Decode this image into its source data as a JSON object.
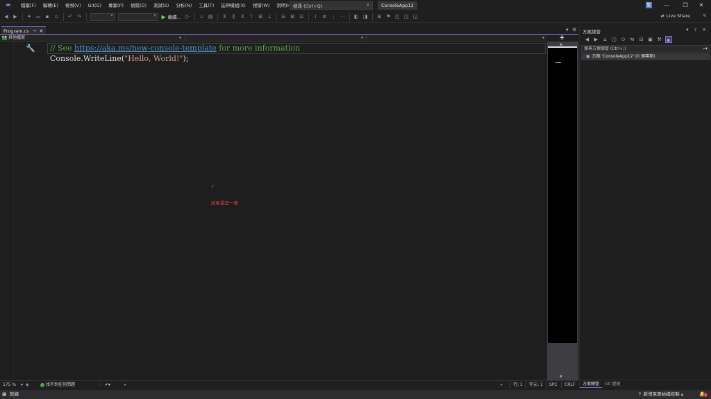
{
  "menu": {
    "items": [
      "檔案(F)",
      "編輯(E)",
      "檢視(V)",
      "Git(G)",
      "專案(P)",
      "偵錯(D)",
      "測試(S)",
      "分析(N)",
      "工具(T)",
      "延伸模組(X)",
      "視窗(W)",
      "說明(H)"
    ],
    "search_placeholder": "搜尋 (Ctrl+Q)",
    "app_title": "ConsoleApp12",
    "avatar_initial": "聖",
    "minimize": "—",
    "restore": "❐",
    "close": "✕"
  },
  "toolbar": {
    "run_label": "繼續...",
    "liveshare_label": "Live Share"
  },
  "tabs": {
    "active_tab": "Program.cs",
    "pin_glyph": "⇔",
    "close_glyph": "✕"
  },
  "navbar": {
    "project_scope": "其他檔案",
    "cs_badge": "C#"
  },
  "editor": {
    "line1_comment_prefix": "// See ",
    "line1_link": "https://aka.ms/new-console-template",
    "line1_comment_suffix": " for more information",
    "line2_call": "Console.WriteLine(",
    "line2_string": "\"Hello, World!\"",
    "line2_end": ");",
    "note_number": "7",
    "note_text": "結果還是一樣"
  },
  "editor_status": {
    "zoom": "175 %",
    "issues": "找不到任何問題",
    "line": "行: 1",
    "char": "字元: 1",
    "spc": "SPC",
    "crlf": "CRLF"
  },
  "solution_explorer": {
    "title": "方案總管",
    "search_placeholder": "搜尋方案總管 (Ctrl+;)",
    "solution_row": "方案 'ConsoleApp12' (0 個專案)",
    "tab_solution": "方案總管",
    "tab_git": "Git 變更"
  },
  "statusbar": {
    "ready": "就緒",
    "add_source": "↑ 新增至原始檔控制 ▴",
    "notifications": "1"
  },
  "colors": {
    "accent": "#8a63d2",
    "comment": "#57a64a",
    "link": "#4e94ce",
    "string": "#d69d85",
    "note": "#e04040"
  }
}
